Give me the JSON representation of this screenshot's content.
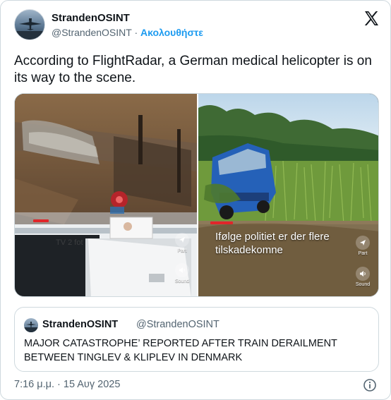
{
  "author": {
    "name": "StrandenOSINT",
    "handle": "@StrandenOSINT",
    "separator": "·",
    "follow_label": "Ακολουθήστε"
  },
  "tweet": {
    "text": "According to FlightRadar, a German medical helicopter is on its way to the scene."
  },
  "media": {
    "left_video": {
      "overlay_text": "TV 2 fot",
      "share_label": "Part",
      "sound_label": "Sound"
    },
    "right_video": {
      "caption": "Ifølge politiet er der flere tilskadekomne",
      "share_label": "Part",
      "sound_label": "Sound"
    }
  },
  "quoted_tweet": {
    "name": "StrandenOSINT",
    "handle": "@StrandenOSINT",
    "text": "MAJOR CATASTROPHE’ REPORTED AFTER TRAIN DERAILMENT BETWEEN TINGLEV & KLIPLEV IN DENMARK"
  },
  "footer": {
    "timestamp": "7:16 μ.μ. · 15 Αυγ 2025"
  },
  "colors": {
    "accent": "#1d9bf0",
    "secondary_text": "#536471",
    "border": "#cfd9de",
    "overlay_red": "#e0262a"
  },
  "icons": {
    "x_logo": "x-logo-icon",
    "info": "info-icon",
    "share": "share-icon",
    "sound": "sound-icon"
  }
}
